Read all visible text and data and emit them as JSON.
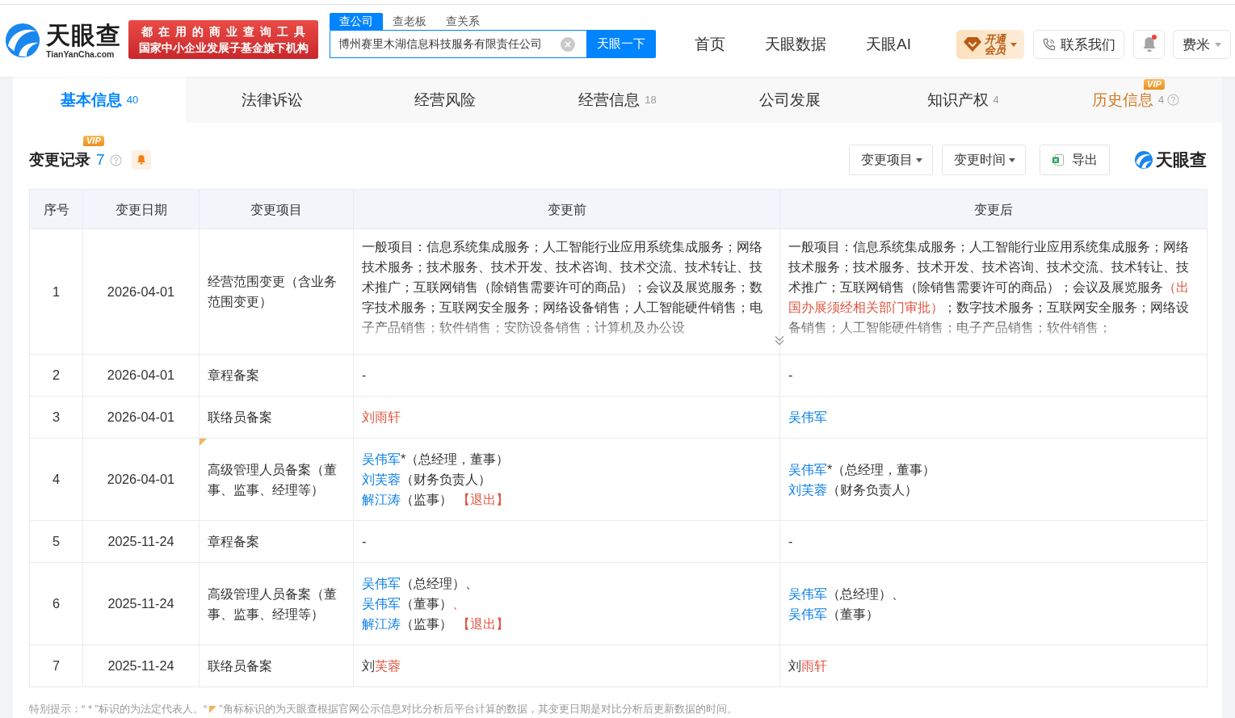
{
  "header": {
    "logo": {
      "name": "天眼查",
      "domain": "TianYanCha.com"
    },
    "slogan": [
      "都在用的商业查询工具",
      "国家中小企业发展子基金旗下机构"
    ],
    "search": {
      "tabs": [
        {
          "label": "查公司",
          "selected": true
        },
        {
          "label": "查老板",
          "selected": false
        },
        {
          "label": "查关系",
          "selected": false
        }
      ],
      "value": "博州赛里木湖信息科技服务有限责任公司",
      "button": "天眼一下"
    },
    "nav": [
      "首页",
      "天眼数据",
      "天眼AI"
    ],
    "vip_button": "开通会员",
    "contact_button": "联系我们",
    "notifications": {
      "unread": true
    },
    "user": "费米"
  },
  "tabs": [
    {
      "label": "基本信息",
      "count": "40",
      "selected": true
    },
    {
      "label": "法律诉讼",
      "selected": false
    },
    {
      "label": "经营风险",
      "selected": false
    },
    {
      "label": "经营信息",
      "count": "18",
      "selected": false
    },
    {
      "label": "公司发展",
      "selected": false
    },
    {
      "label": "知识产权",
      "count": "4",
      "selected": false
    },
    {
      "label": "历史信息",
      "count": "4",
      "selected": false,
      "badge": "VIP",
      "help": true
    }
  ],
  "section": {
    "title": "变更记录",
    "count": "7",
    "badge": "VIP",
    "filters": [
      "变更项目",
      "变更时间"
    ],
    "export": "导出",
    "brand": "天眼查"
  },
  "table": {
    "columns": [
      "序号",
      "变更日期",
      "变更项目",
      "变更前",
      "变更后"
    ],
    "rows": [
      {
        "index": "1",
        "date": "2026-04-01",
        "item": "经营范围变更（含业务范围变更）",
        "computed": false,
        "before": {
          "collapsed": true,
          "expand": true,
          "lines": [
            [
              {
                "kind": "text",
                "text": "一般项目：信息系统集成服务；人工智能行业应用系统集成服务；网络技术服务；技术服务、技术开发、技术咨询、技术交流、技术转让、技术推广；互联网销售（除销售需要许可的商品）；会议及展览服务；数字技术服务；互联网安全服务；网络设备销售；人工智能硬件销售；电子产品销售；软件销售；安防设备销售；计算机及办公设"
              }
            ]
          ]
        },
        "after": {
          "collapsed": true,
          "expand": false,
          "lines": [
            [
              {
                "kind": "text",
                "text": "一般项目：信息系统集成服务；人工智能行业应用系统集成服务；网络技术服务；技术服务、技术开发、技术咨询、技术交流、技术转让、技术推广；互联网销售（除销售需要许可的商品）；会议及展览服务"
              },
              {
                "kind": "changed",
                "text": "（出国办展须经相关部门审批）"
              },
              {
                "kind": "text",
                "text": "；数字技术服务；互联网安全服务；网络设备销售；人工智能硬件销售；电子产品销售；软件销售；"
              }
            ]
          ]
        }
      },
      {
        "index": "2",
        "date": "2026-04-01",
        "item": "章程备案",
        "computed": false,
        "before": {
          "lines": [
            [
              {
                "kind": "text",
                "text": "-"
              }
            ]
          ]
        },
        "after": {
          "lines": [
            [
              {
                "kind": "text",
                "text": "-"
              }
            ]
          ]
        }
      },
      {
        "index": "3",
        "date": "2026-04-01",
        "item": "联络员备案",
        "computed": false,
        "before": {
          "lines": [
            [
              {
                "kind": "changed",
                "text": "刘雨轩"
              }
            ]
          ]
        },
        "after": {
          "lines": [
            [
              {
                "kind": "link",
                "text": "吴伟军"
              }
            ]
          ]
        }
      },
      {
        "index": "4",
        "date": "2026-04-01",
        "item": "高级管理人员备案（董事、监事、经理等）",
        "computed": true,
        "before": {
          "lines": [
            [
              {
                "kind": "link",
                "text": "吴伟军"
              },
              {
                "kind": "text",
                "text": "*（总经理，董事）"
              }
            ],
            [
              {
                "kind": "link",
                "text": "刘芙蓉"
              },
              {
                "kind": "text",
                "text": "（财务负责人）"
              }
            ],
            [
              {
                "kind": "link",
                "text": "解江涛"
              },
              {
                "kind": "text",
                "text": "（监事）"
              },
              {
                "kind": "exit",
                "text": "【退出】"
              }
            ]
          ]
        },
        "after": {
          "lines": [
            [
              {
                "kind": "link",
                "text": "吴伟军"
              },
              {
                "kind": "text",
                "text": "*（总经理，董事）"
              }
            ],
            [
              {
                "kind": "link",
                "text": "刘芙蓉"
              },
              {
                "kind": "text",
                "text": "（财务负责人）"
              }
            ]
          ]
        }
      },
      {
        "index": "5",
        "date": "2025-11-24",
        "item": "章程备案",
        "computed": false,
        "before": {
          "lines": [
            [
              {
                "kind": "text",
                "text": "-"
              }
            ]
          ]
        },
        "after": {
          "lines": [
            [
              {
                "kind": "text",
                "text": "-"
              }
            ]
          ]
        }
      },
      {
        "index": "6",
        "date": "2025-11-24",
        "item": "高级管理人员备案（董事、监事、经理等）",
        "computed": false,
        "before": {
          "lines": [
            [
              {
                "kind": "link",
                "text": "吴伟军"
              },
              {
                "kind": "text",
                "text": "（总经理）、"
              }
            ],
            [
              {
                "kind": "link",
                "text": "吴伟军"
              },
              {
                "kind": "text",
                "text": "（董事）"
              },
              {
                "kind": "changed",
                "text": "、"
              }
            ],
            [
              {
                "kind": "link",
                "text": "解江涛"
              },
              {
                "kind": "text",
                "text": "（监事）"
              },
              {
                "kind": "exit",
                "text": "【退出】"
              }
            ]
          ]
        },
        "after": {
          "lines": [
            [
              {
                "kind": "link",
                "text": "吴伟军"
              },
              {
                "kind": "text",
                "text": "（总经理）、"
              }
            ],
            [
              {
                "kind": "link",
                "text": "吴伟军"
              },
              {
                "kind": "text",
                "text": "（董事）"
              }
            ]
          ]
        }
      },
      {
        "index": "7",
        "date": "2025-11-24",
        "item": "联络员备案",
        "computed": false,
        "before": {
          "lines": [
            [
              {
                "kind": "text",
                "text": "刘"
              },
              {
                "kind": "changed",
                "text": "芙蓉"
              }
            ]
          ]
        },
        "after": {
          "lines": [
            [
              {
                "kind": "text",
                "text": "刘"
              },
              {
                "kind": "changed",
                "text": "雨轩"
              }
            ]
          ]
        }
      }
    ]
  },
  "footnote": [
    "特别提示：“ * ”标识的为法定代表人。“",
    "”角标标识的为天眼查根据官网公示信息对比分析后平台计算的数据，其变更日期是对比分析后更新数据的时间。"
  ]
}
